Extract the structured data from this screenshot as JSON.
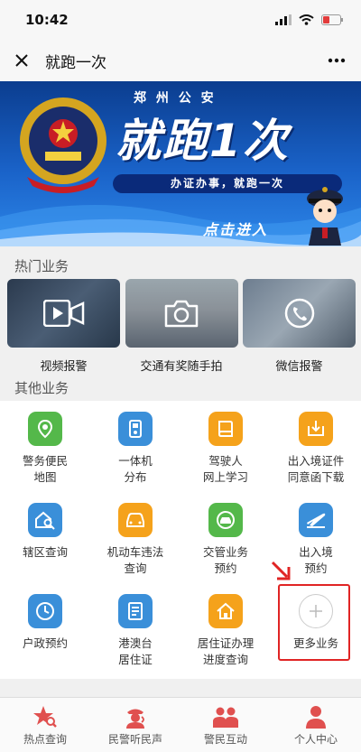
{
  "status_bar": {
    "time": "10:42"
  },
  "title_bar": {
    "title": "就跑一次"
  },
  "banner": {
    "subtitle": "郑 州 公 安",
    "title": "就跑1次",
    "slogan": "办证办事，就跑一次",
    "enter_label": "点击进入"
  },
  "hot_section": {
    "title": "热门业务",
    "items": [
      {
        "label": "视频报警",
        "icon": "video-call-icon"
      },
      {
        "label": "交通有奖随手拍",
        "icon": "camera-icon"
      },
      {
        "label": "微信报警",
        "icon": "phone-icon"
      }
    ]
  },
  "other_section": {
    "title": "其他业务",
    "items": [
      {
        "line1": "警务便民",
        "line2": "地图",
        "icon": "map-pin-icon",
        "color": "#54b84a"
      },
      {
        "line1": "一体机",
        "line2": "分布",
        "icon": "kiosk-icon",
        "color": "#3a8fd9"
      },
      {
        "line1": "驾驶人",
        "line2": "网上学习",
        "icon": "book-icon",
        "color": "#f5a21b"
      },
      {
        "line1": "出入境证件",
        "line2": "同意函下载",
        "icon": "download-icon",
        "color": "#f5a21b"
      },
      {
        "line1": "辖区查询",
        "line2": "",
        "icon": "house-search-icon",
        "color": "#3a8fd9"
      },
      {
        "line1": "机动车违法",
        "line2": "查询",
        "icon": "car-icon",
        "color": "#f5a21b"
      },
      {
        "line1": "交管业务",
        "line2": "预约",
        "icon": "car-check-icon",
        "color": "#54b84a"
      },
      {
        "line1": "出入境",
        "line2": "预约",
        "icon": "airplane-icon",
        "color": "#3a8fd9"
      },
      {
        "line1": "户政预约",
        "line2": "",
        "icon": "clock-icon",
        "color": "#3a8fd9"
      },
      {
        "line1": "港澳台",
        "line2": "居住证",
        "icon": "document-icon",
        "color": "#3a8fd9"
      },
      {
        "line1": "居住证办理",
        "line2": "进度查询",
        "icon": "home-icon",
        "color": "#f5a21b"
      },
      {
        "line1": "更多业务",
        "line2": "",
        "icon": "plus-icon",
        "color": "#cccccc"
      }
    ]
  },
  "tabbar": {
    "items": [
      {
        "label": "热点查询",
        "icon": "star-search-icon"
      },
      {
        "label": "民警听民声",
        "icon": "police-officer-icon"
      },
      {
        "label": "警民互动",
        "icon": "people-icon"
      },
      {
        "label": "个人中心",
        "icon": "user-icon"
      }
    ],
    "accent_color": "#e0504f"
  }
}
